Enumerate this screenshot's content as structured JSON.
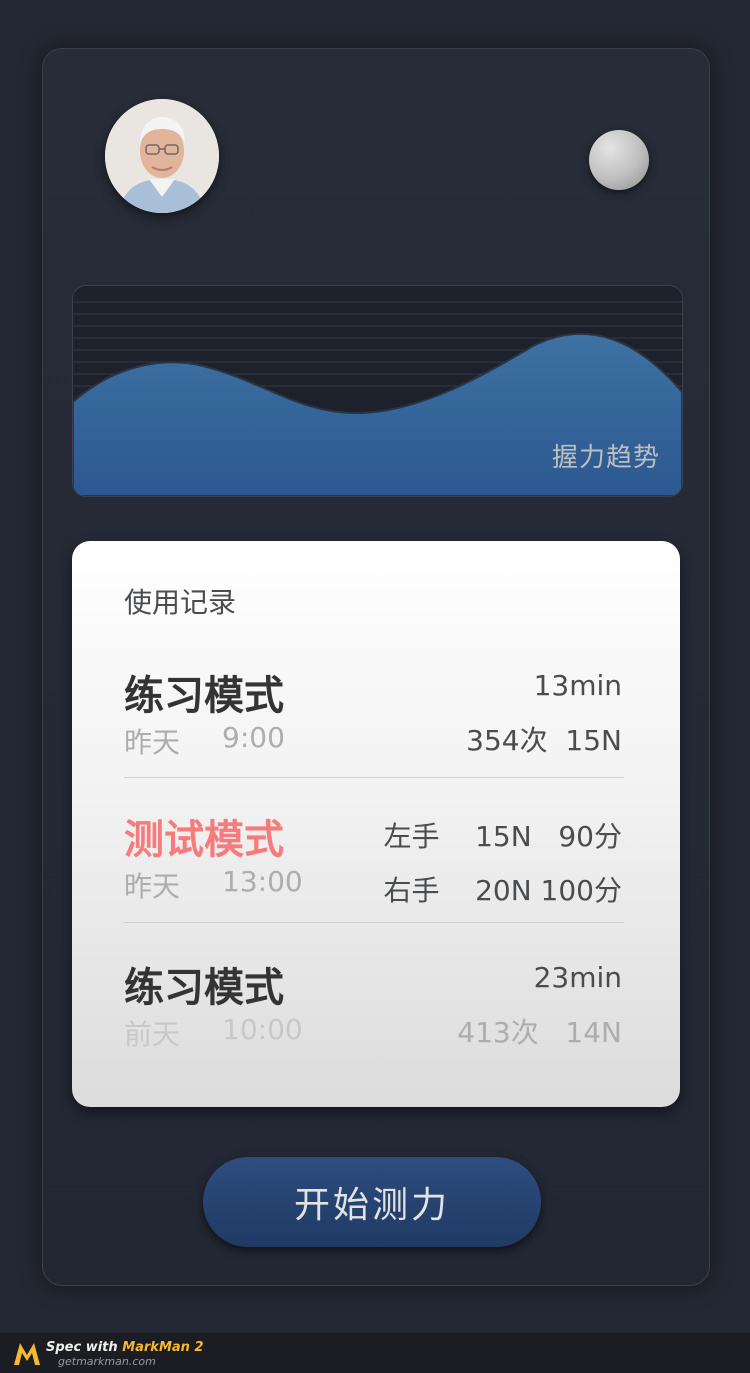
{
  "chart": {
    "title": "握力趋势"
  },
  "records": {
    "title": "使用记录",
    "entries": [
      {
        "mode": "练习模式",
        "date": "昨天",
        "time": "9:00",
        "duration": "13min",
        "stat": "354次  15N"
      },
      {
        "mode": "测试模式",
        "date": "昨天",
        "time": "13:00",
        "left": "左手    15N   90分",
        "right": "右手    20N 100分"
      },
      {
        "mode": "练习模式",
        "date": "前天",
        "time": "10:00",
        "duration": "23min",
        "stat": "413次   14N"
      }
    ]
  },
  "start_button": {
    "label": "开始测力"
  },
  "footer": {
    "spec_prefix": "Spec with ",
    "brand": "MarkMan 2",
    "url": "getmarkman.com"
  },
  "colors": {
    "background": "#242834",
    "chart_wave": "#3f73a3",
    "chart_title": "#bebec1",
    "text_primary": "#343434",
    "text_secondary": "#4b4c4e",
    "text_muted": "#acadae",
    "divider": "#d0cece",
    "test_mode": "#f67b7b",
    "button_text": "#e3e3e3"
  }
}
